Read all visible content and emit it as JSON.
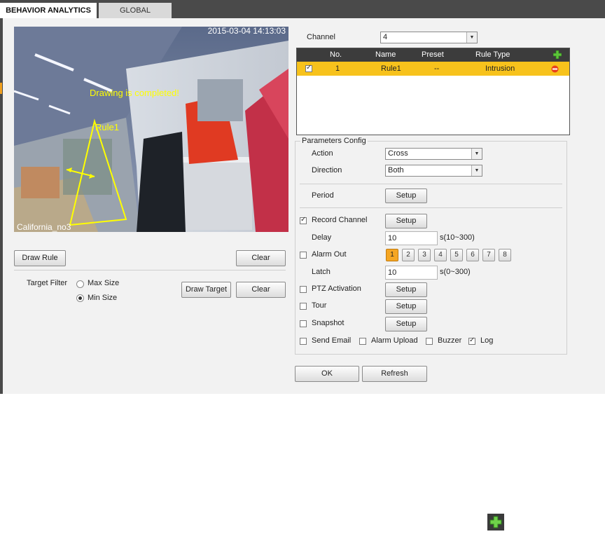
{
  "tabs": [
    {
      "label": "BEHAVIOR ANALYTICS",
      "active": true
    },
    {
      "label": "GLOBAL",
      "active": false
    }
  ],
  "video": {
    "timestamp": "2015-03-04 14:13:03",
    "status_text": "Drawing is completed!",
    "rule_label": "Rule1",
    "channel_name": "California_no3",
    "overlay_color": "#ffff00"
  },
  "left_controls": {
    "draw_rule_label": "Draw Rule",
    "clear_label": "Clear",
    "target_filter_label": "Target Filter",
    "max_size_label": "Max Size",
    "min_size_label": "Min Size",
    "selected_size": "Min Size",
    "draw_target_label": "Draw Target",
    "clear2_label": "Clear"
  },
  "channel": {
    "label": "Channel",
    "value": "4"
  },
  "rules_table": {
    "headers": [
      "No.",
      "Name",
      "Preset",
      "Rule Type"
    ],
    "rows": [
      {
        "checked": true,
        "no": "1",
        "name": "Rule1",
        "preset": "--",
        "rule_type": "Intrusion"
      }
    ],
    "row_highlight_color": "#f7c21c"
  },
  "params": {
    "title": "Parameters Config",
    "action_label": "Action",
    "action_value": "Cross",
    "direction_label": "Direction",
    "direction_value": "Both",
    "period_label": "Period",
    "setup_label": "Setup",
    "record_channel_label": "Record Channel",
    "record_channel_checked": true,
    "delay_label": "Delay",
    "delay_value": "10",
    "delay_range": "s(10~300)",
    "alarm_out_label": "Alarm Out",
    "alarm_out_checked": false,
    "alarm_outputs": [
      "1",
      "2",
      "3",
      "4",
      "5",
      "6",
      "7",
      "8"
    ],
    "alarm_output_selected": "1",
    "latch_label": "Latch",
    "latch_value": "10",
    "latch_range": "s(0~300)",
    "ptz_label": "PTZ Activation",
    "tour_label": "Tour",
    "snapshot_label": "Snapshot",
    "send_email_label": "Send Email",
    "alarm_upload_label": "Alarm Upload",
    "buzzer_label": "Buzzer",
    "log_label": "Log",
    "log_checked": true
  },
  "footer": {
    "ok_label": "OK",
    "refresh_label": "Refresh"
  }
}
